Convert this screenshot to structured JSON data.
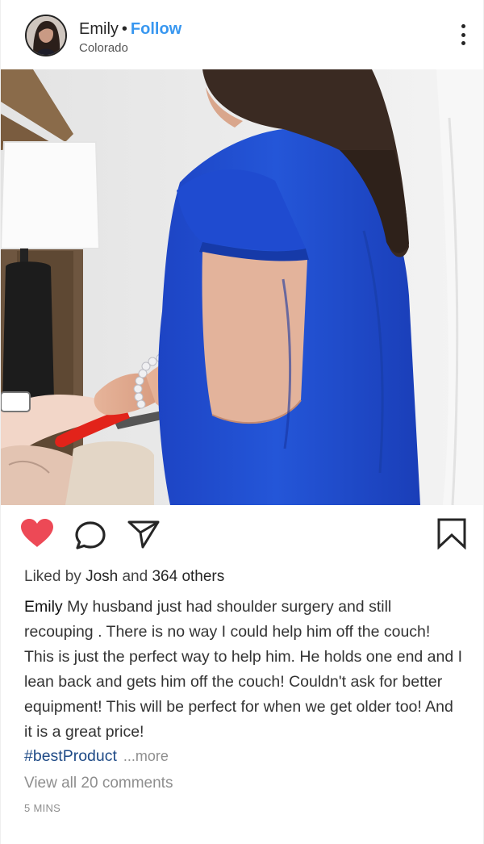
{
  "header": {
    "username": "Emily",
    "separator": "•",
    "follow_label": "Follow",
    "location": "Colorado",
    "more_icon": "more-vertical-icon"
  },
  "photo": {
    "icon": "post-photo"
  },
  "actions": {
    "like_icon": "heart-icon",
    "comment_icon": "comment-icon",
    "share_icon": "share-icon",
    "save_icon": "bookmark-icon",
    "like_color": "#ed4956"
  },
  "likes": {
    "prefix": "Liked by",
    "user": "Josh",
    "middle": "and",
    "others": "364 others"
  },
  "caption": {
    "username": "Emily",
    "text": "My husband just had shoulder surgery and still recouping . There is no way I could help him off the couch! This is just the perfect way to help him. He holds one end and I lean back and gets him off the couch! Couldn't ask for better equipment! This will be perfect for when we get older too! And it is a great price!",
    "hashtag": "#bestProduct",
    "more_label": "...more"
  },
  "comments": {
    "view_all_label": "View all 20 comments"
  },
  "timestamp": "5 MINS",
  "colors": {
    "follow": "#3897f0",
    "hashtag": "#1e4a86",
    "muted": "#8e8e8e"
  }
}
